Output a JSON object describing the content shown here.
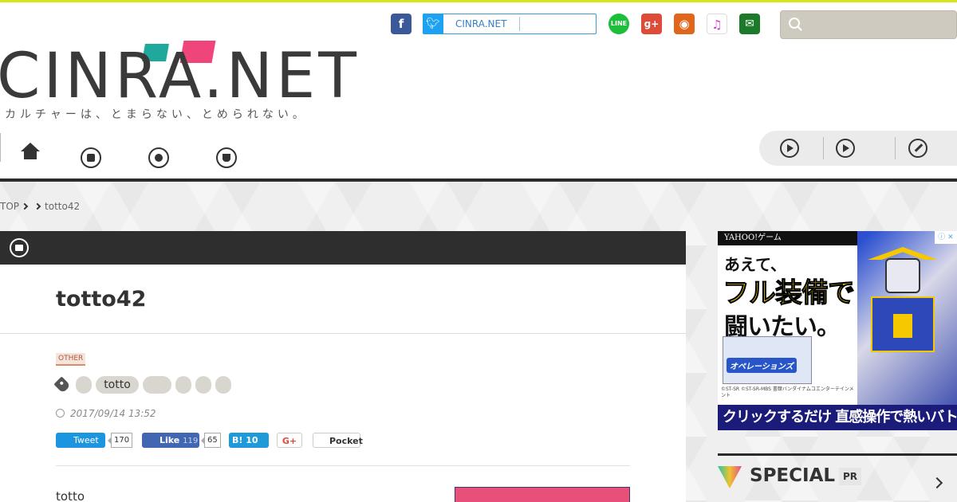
{
  "brand": {
    "logo_text": "CINRA.NET",
    "tagline": "カルチャーは、とまらない、とめられない。",
    "accent_colors": {
      "top_line": "#d6e51a",
      "bubble_green": "#1fa99c",
      "bubble_pink": "#f0457a"
    }
  },
  "share_bar": {
    "twitter_label": "CINRA.NET",
    "icons": [
      "facebook-icon",
      "twitter-icon",
      "line-icon",
      "google-plus-icon",
      "rss-icon",
      "itunes-icon",
      "mail-icon"
    ]
  },
  "search": {
    "placeholder": ""
  },
  "nav": {
    "left_icons": [
      "home-icon",
      "news-icon",
      "people-icon",
      "shop-icon"
    ],
    "right_icons": [
      "play-icon",
      "play-alt-icon",
      "edit-icon"
    ]
  },
  "breadcrumb": {
    "top": "TOP",
    "current": "totto42"
  },
  "article": {
    "title": "totto42",
    "category": "OTHER",
    "tags": [
      "",
      "totto",
      "",
      "",
      "",
      ""
    ],
    "date": "2017/09/14 13:52",
    "social": {
      "tweet_label": "Tweet",
      "tweet_count": "170",
      "like_label": "Like",
      "like_count_inline": "119",
      "like_count": "65",
      "hatena_label": "B!",
      "hatena_count": "10",
      "gplus_label": "G+",
      "pocket_label": "Pocket"
    },
    "body_start": "totto"
  },
  "ad": {
    "provider": "YAHOO!ゲーム",
    "headline_1": "あえて、",
    "headline_2": "フル装備で",
    "headline_3": "闘いたい。",
    "game_title": "オペレーションズ",
    "copyright": "©ST-SR ©ST-SR-MBS\n書肆バンダイナムコエンターテインメント",
    "cta": "クリックするだけ 直感操作で熱いバトル!≫",
    "close_label": "ⓘ ✕"
  },
  "special": {
    "label": "SPECIAL",
    "badge": "PR"
  }
}
